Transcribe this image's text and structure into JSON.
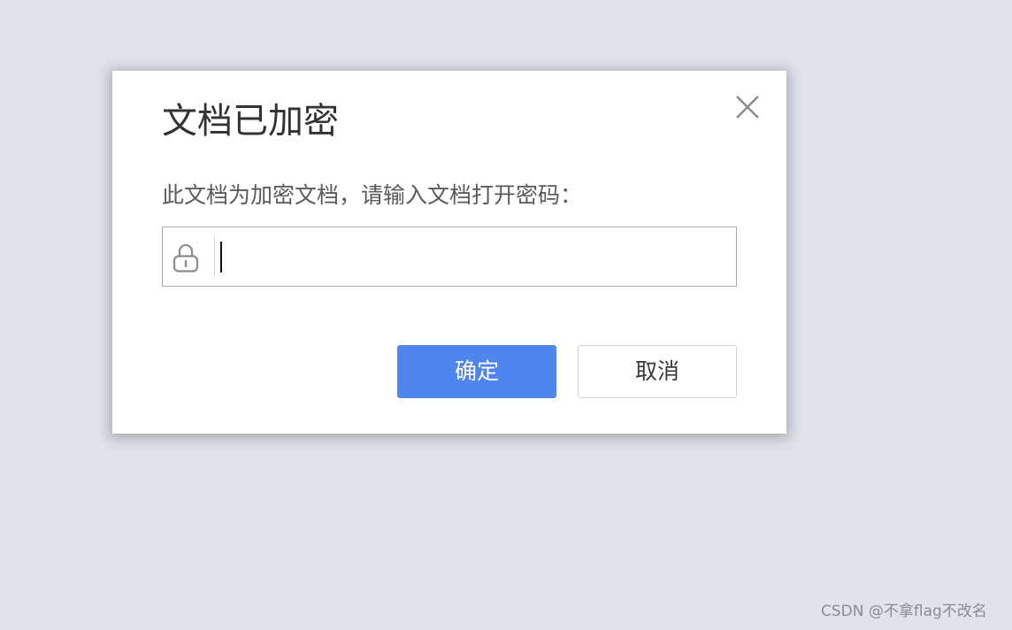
{
  "dialog": {
    "title": "文档已加密",
    "message": "此文档为加密文档，请输入文档打开密码：",
    "password_field": {
      "value": "",
      "placeholder": ""
    },
    "confirm_label": "确定",
    "cancel_label": "取消"
  },
  "icons": {
    "close": "close-icon",
    "lock": "lock-icon"
  },
  "colors": {
    "accent": "#5185ee",
    "background": "#e1e3ea",
    "dialog": "#ffffff"
  },
  "watermark": "CSDN @不拿flag不改名"
}
